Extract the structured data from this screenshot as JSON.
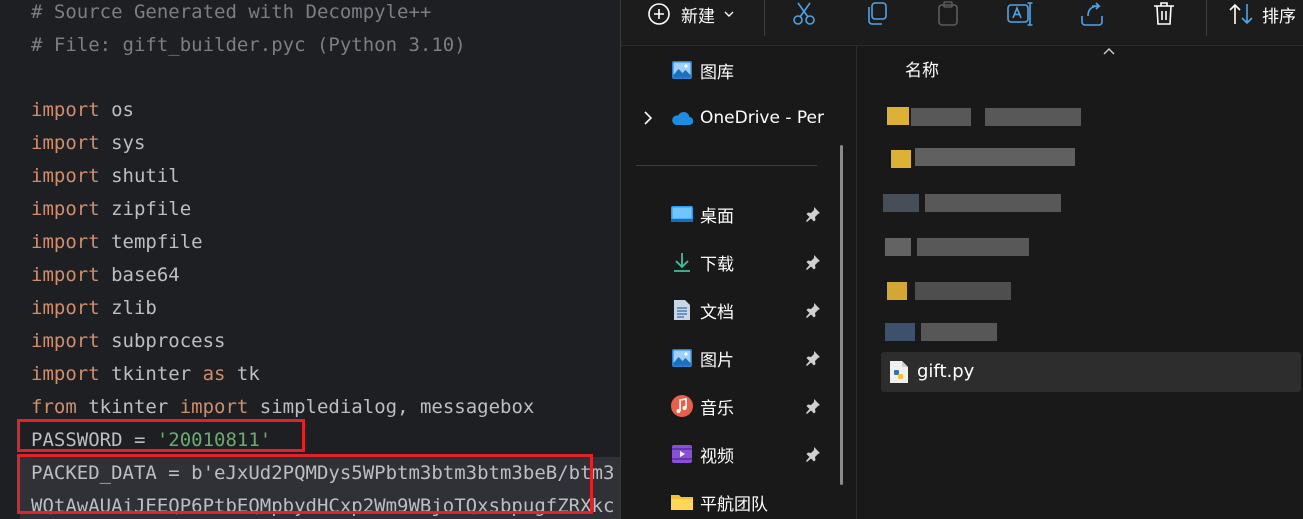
{
  "editor": {
    "lines": [
      {
        "comment": "# Source Generated with Decompyle++"
      },
      {
        "comment": "# File: gift_builder.pyc (Python 3.10)"
      },
      {
        "comment": ""
      },
      {
        "kw": "import",
        "rest": " os"
      },
      {
        "kw": "import",
        "rest": " sys"
      },
      {
        "kw": "import",
        "rest": " shutil"
      },
      {
        "kw": "import",
        "rest": " zipfile"
      },
      {
        "kw": "import",
        "rest": " tempfile"
      },
      {
        "kw": "import",
        "rest": " base64"
      },
      {
        "kw": "import",
        "rest": " zlib"
      },
      {
        "kw": "import",
        "rest": " subprocess"
      },
      {
        "kw": "import",
        "rest": " tkinter ",
        "kw2": "as",
        "rest2": " tk"
      },
      {
        "kw": "from",
        "rest": " tkinter ",
        "kw2": "import",
        "rest2": " simpledialog, messagebox"
      },
      {
        "plain": "PASSWORD = ",
        "str": "'20010811'"
      },
      {
        "plain": "PACKED_DATA = b'eJxUd2PQMDys5WPbtm3btm3btm3beB/btm3"
      },
      {
        "plain": "WQtAwAUAiJEEQP6PtbEQMpbydHCxp2Wm9WBjoTQxsbpugfZRXkc"
      }
    ]
  },
  "explorer": {
    "toolbar": {
      "new_label": "新建",
      "sort_label": "排序"
    },
    "nav": [
      {
        "label": "图库",
        "icon": "gallery-icon",
        "pinned": false
      },
      {
        "label": "OneDrive - Per",
        "icon": "onedrive-cloud-icon",
        "pinned": false,
        "expandable": true
      },
      {
        "label": "桌面",
        "icon": "desktop-icon",
        "pinned": true
      },
      {
        "label": "下载",
        "icon": "download-icon",
        "pinned": true
      },
      {
        "label": "文档",
        "icon": "documents-icon",
        "pinned": true
      },
      {
        "label": "图片",
        "icon": "pictures-icon",
        "pinned": true
      },
      {
        "label": "音乐",
        "icon": "music-icon",
        "pinned": true
      },
      {
        "label": "视频",
        "icon": "videos-icon",
        "pinned": true
      },
      {
        "label": "平航团队",
        "icon": "folder-icon",
        "pinned": false
      }
    ],
    "content": {
      "column_header": "名称",
      "selected_file": "gift.py"
    }
  }
}
